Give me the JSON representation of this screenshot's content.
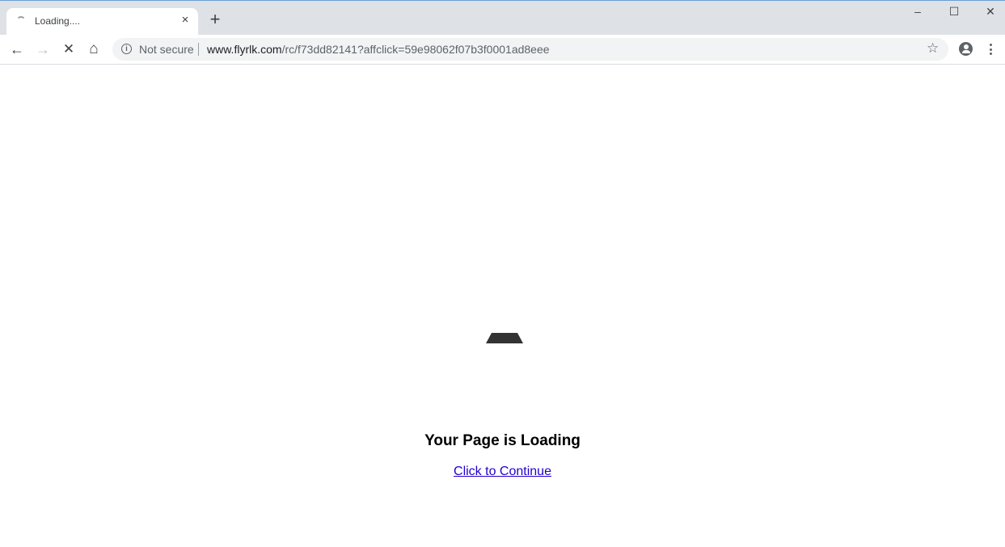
{
  "browser": {
    "tab": {
      "title": "Loading....",
      "close_label": "×"
    },
    "new_tab_label": "+",
    "window_controls": {
      "minimize": "–",
      "maximize": "☐",
      "close": "✕"
    },
    "nav": {
      "back": "←",
      "forward": "→",
      "stop": "✕",
      "home": "⌂"
    },
    "omnibox": {
      "security_label": "Not secure",
      "url_host": "www.flyrlk.com",
      "url_path": "/rc/f73dd82141?affclick=59e98062f07b3f0001ad8eee"
    },
    "star_icon": "☆"
  },
  "page": {
    "heading": "Your Page is Loading",
    "link_text": "Click to Continue"
  }
}
